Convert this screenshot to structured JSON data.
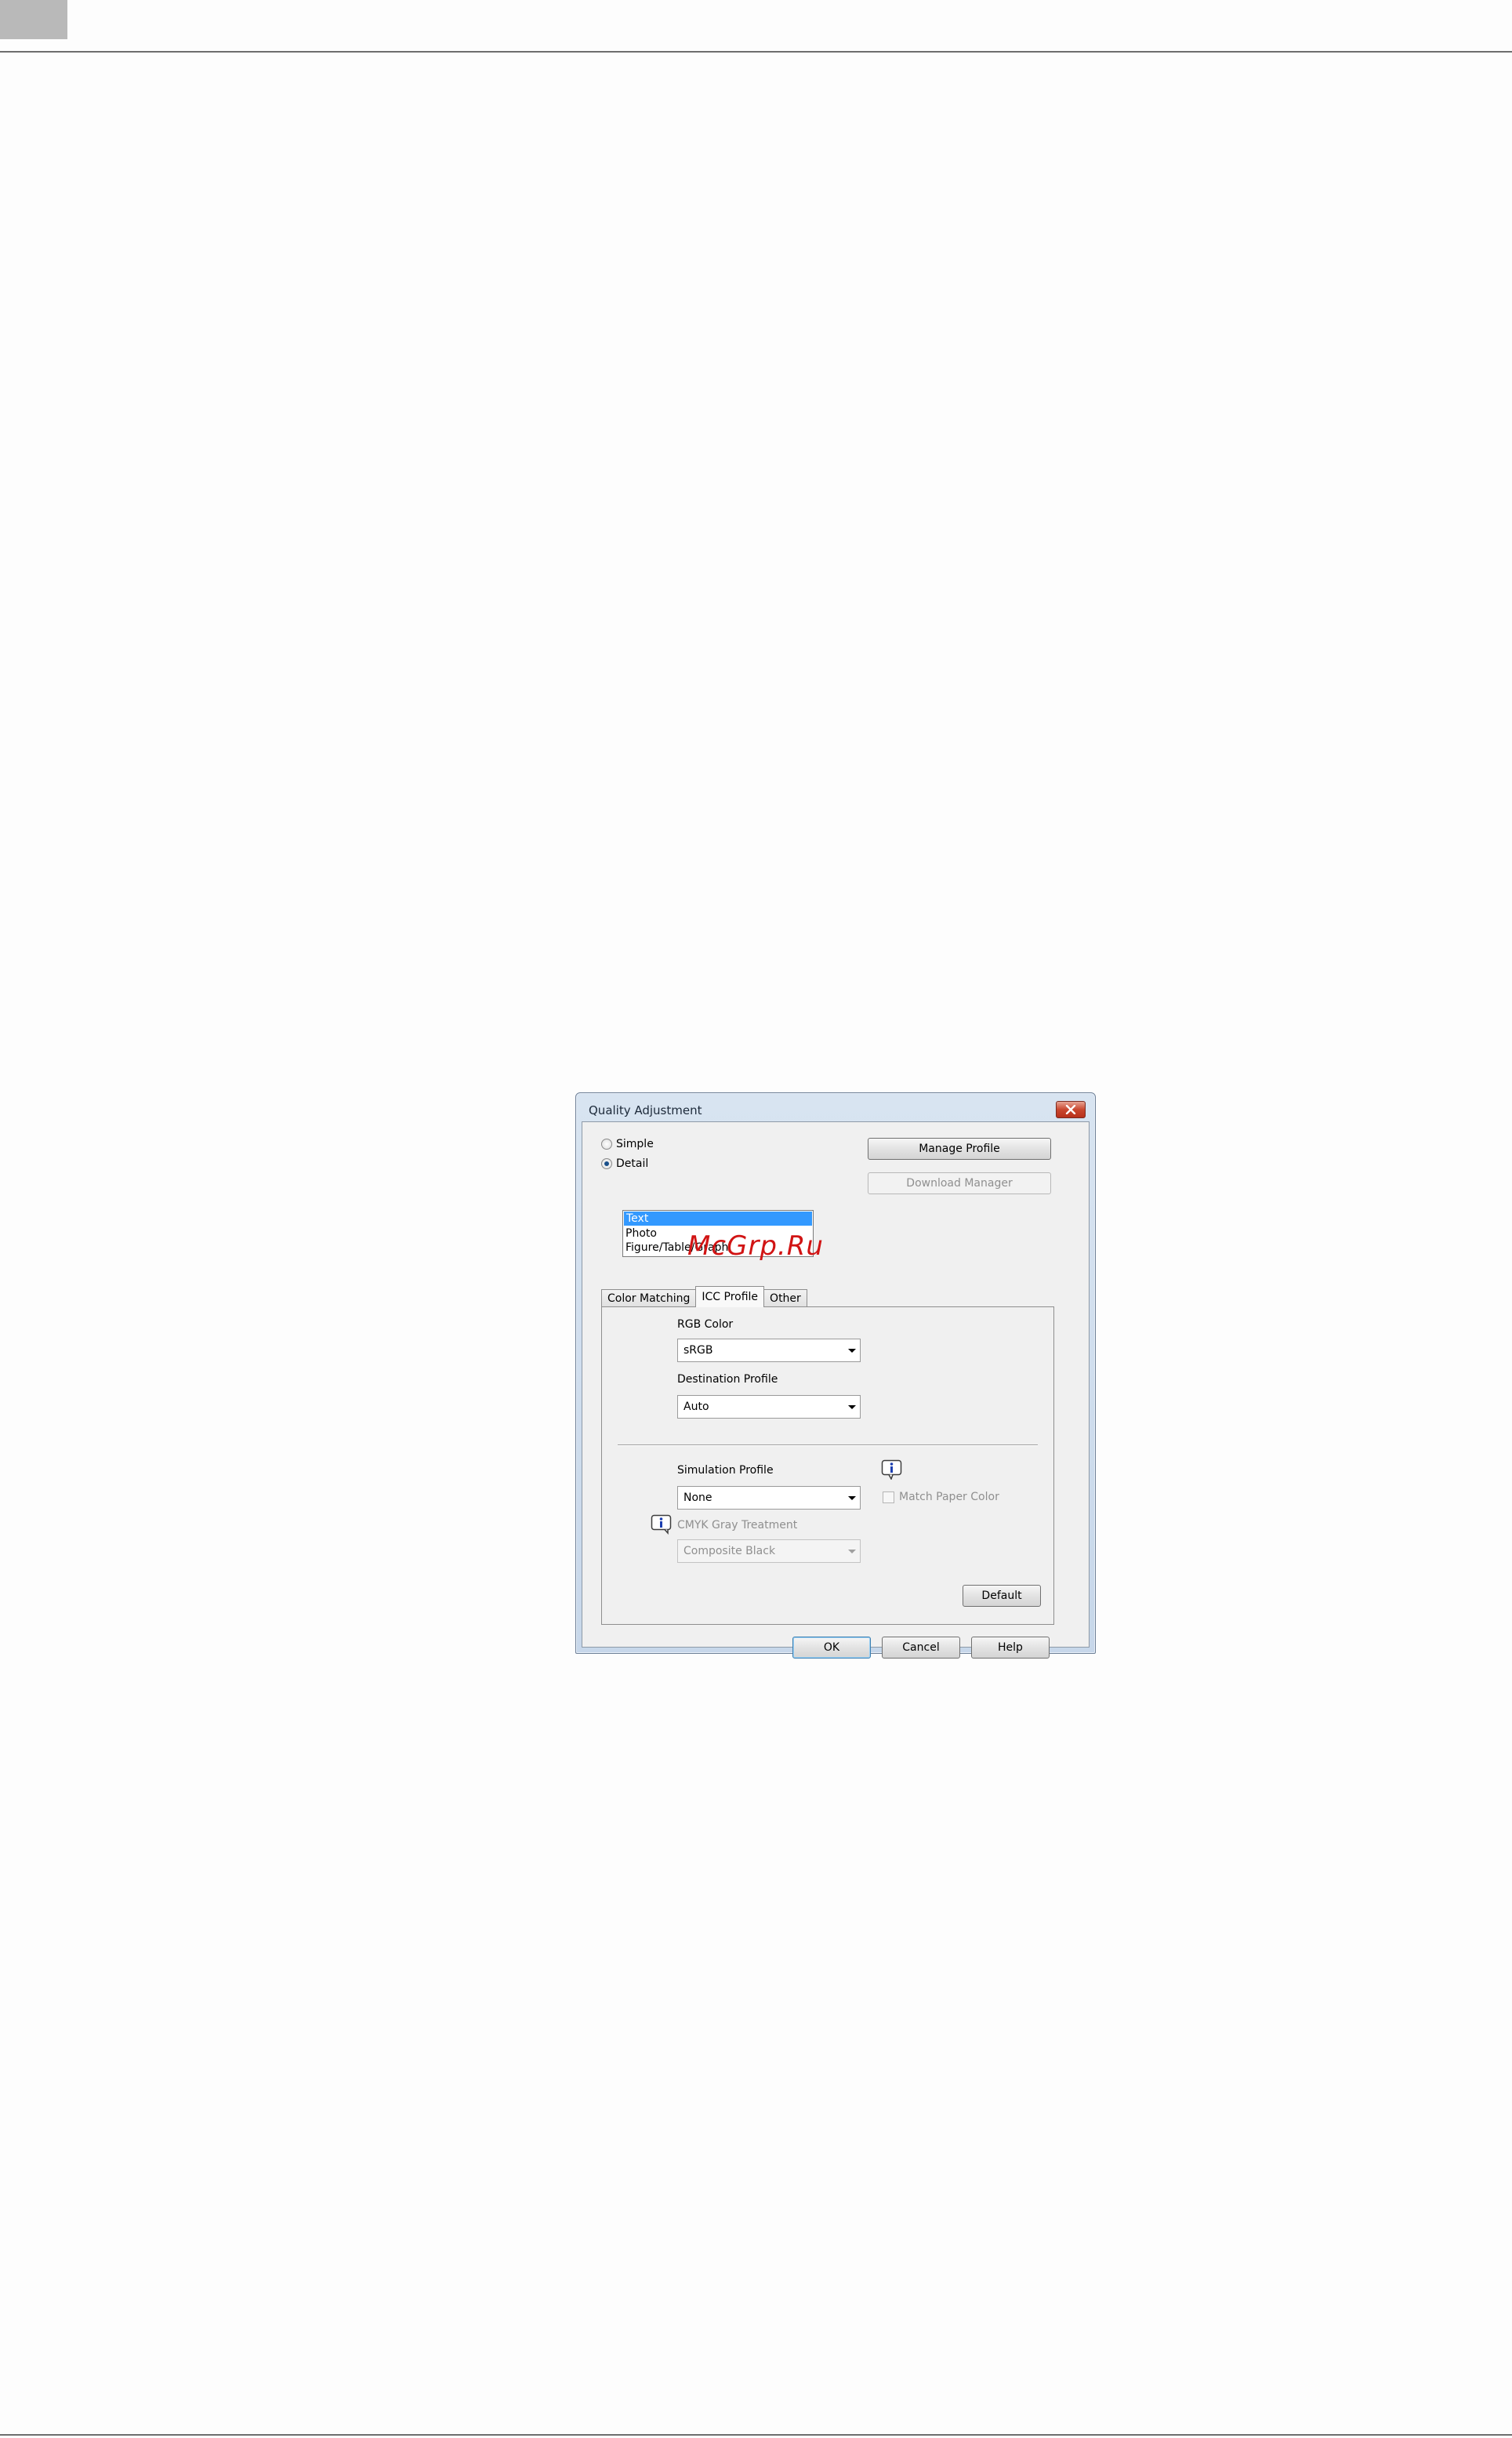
{
  "dialog": {
    "title": "Quality Adjustment",
    "close_icon": "close-icon",
    "mode": {
      "simple_label": "Simple",
      "detail_label": "Detail",
      "selected": "Detail"
    },
    "buttons": {
      "manage_profile": "Manage Profile",
      "download_manager": "Download Manager",
      "default": "Default",
      "ok": "OK",
      "cancel": "Cancel",
      "help": "Help"
    },
    "object_list": {
      "items": [
        "Text",
        "Photo",
        "Figure/Table/Graph"
      ],
      "selected": "Text"
    },
    "watermark": "McGrp.Ru",
    "tabs": [
      "Color Matching",
      "ICC Profile",
      "Other"
    ],
    "active_tab": "ICC Profile",
    "icc": {
      "rgb_color_label": "RGB Color",
      "rgb_color_value": "sRGB",
      "destination_profile_label": "Destination Profile",
      "destination_profile_value": "Auto",
      "simulation_profile_label": "Simulation Profile",
      "simulation_profile_value": "None",
      "match_paper_color_label": "Match Paper Color",
      "cmyk_gray_label": "CMYK Gray Treatment",
      "cmyk_gray_value": "Composite Black"
    }
  },
  "colors": {
    "selection": "#3399ff",
    "watermark": "#d11414",
    "title_bar": "#c7d7ea",
    "close_button": "#c9472f"
  }
}
